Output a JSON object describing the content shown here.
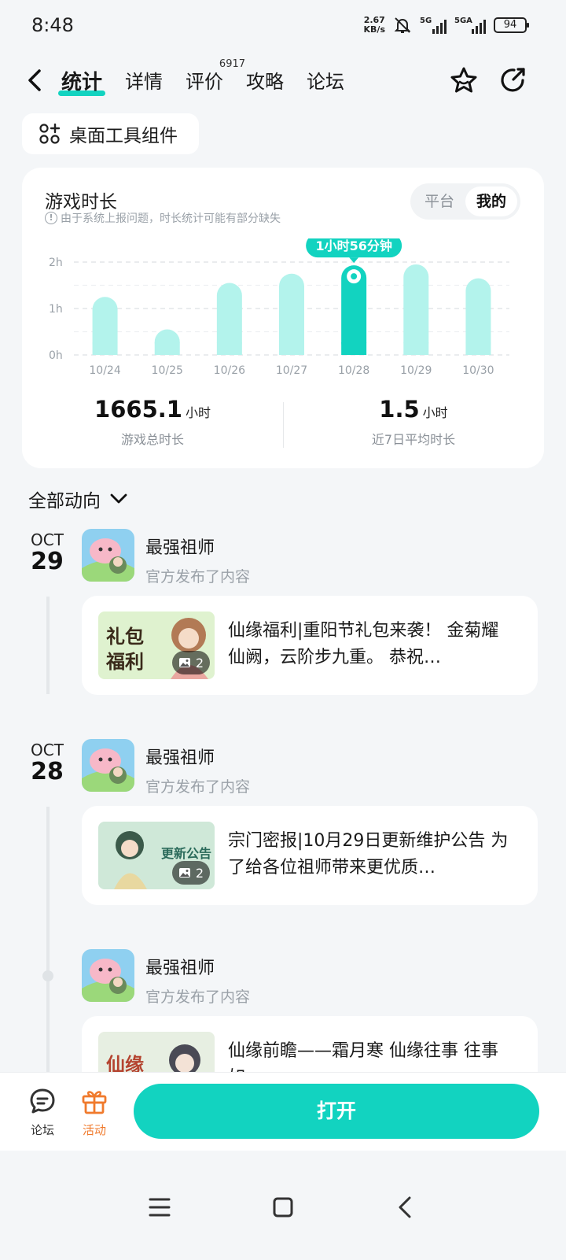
{
  "status": {
    "time": "8:48",
    "net_speed": "2.67",
    "net_unit": "KB/s",
    "sig1": "5G",
    "sig2": "5GA",
    "battery": "94"
  },
  "nav": {
    "tabs": [
      {
        "label": "统计",
        "sup": ""
      },
      {
        "label": "详情",
        "sup": ""
      },
      {
        "label": "评价",
        "sup": "6917"
      },
      {
        "label": "攻略",
        "sup": ""
      },
      {
        "label": "论坛",
        "sup": ""
      }
    ]
  },
  "widget_button": "桌面工具组件",
  "stats": {
    "title": "游戏时长",
    "note": "由于系统上报问题，时长统计可能有部分缺失",
    "toggle": [
      "平台",
      "我的"
    ],
    "total_value": "1665.1",
    "total_unit": "小时",
    "total_label": "游戏总时长",
    "avg_value": "1.5",
    "avg_unit": "小时",
    "avg_label": "近7日平均时长"
  },
  "chart_data": {
    "type": "bar",
    "categories": [
      "10/24",
      "10/25",
      "10/26",
      "10/27",
      "10/28",
      "10/29",
      "10/30"
    ],
    "values": [
      1.25,
      0.55,
      1.55,
      1.75,
      1.93,
      1.95,
      1.65
    ],
    "y_ticks": [
      "0h",
      "1h",
      "2h"
    ],
    "ylim": [
      0,
      2.2
    ],
    "highlight_index": 4,
    "tooltip": "1小时56分钟",
    "grid": true,
    "colors": {
      "bar": "#b3f3ec",
      "highlight": "#12d3c0"
    }
  },
  "feed": {
    "filter": "全部动向",
    "groups": [
      {
        "month": "OCT",
        "day": "29",
        "posts": [
          {
            "author": "最强祖师",
            "sub": "官方发布了内容",
            "thumb_text": "礼包\n福利",
            "count": "2",
            "text": "仙缘福利|重阳节礼包来袭！ 金菊耀仙阙，云阶步九重。 恭祝…"
          }
        ]
      },
      {
        "month": "OCT",
        "day": "28",
        "posts": [
          {
            "author": "最强祖师",
            "sub": "官方发布了内容",
            "thumb_text": "更新公告",
            "count": "2",
            "text": "宗门密报|10月29日更新维护公告 为了给各位祖师带来更优质…"
          },
          {
            "author": "最强祖师",
            "sub": "官方发布了内容",
            "thumb_text": "仙缘",
            "count": "",
            "text": "仙缘前瞻——霜月寒 仙缘往事 往事如……"
          }
        ]
      }
    ]
  },
  "bottom": {
    "forum": "论坛",
    "activity": "活动",
    "open": "打开"
  }
}
